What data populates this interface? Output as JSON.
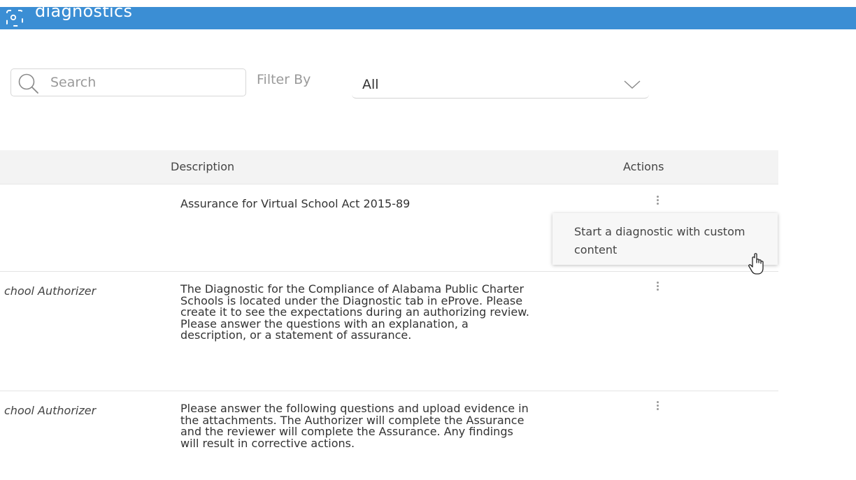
{
  "header": {
    "title": "diagnostics",
    "icon": "diagnostics-icon",
    "color": "#3b8ed4"
  },
  "search": {
    "placeholder": "Search",
    "value": ""
  },
  "filter": {
    "label": "Filter By",
    "selected": "All"
  },
  "table": {
    "columns": {
      "description": "Description",
      "actions": "Actions"
    },
    "rows": [
      {
        "name": "",
        "description": "Assurance for Virtual School Act 2015-89"
      },
      {
        "name": "chool Authorizer",
        "description": "The Diagnostic for the Compliance of Alabama Public Charter Schools is located under the Diagnostic tab in eProve. Please create it to see the expectations during an authorizing review. Please answer the questions with an explanation, a description, or a statement of assurance."
      },
      {
        "name": "chool Authorizer",
        "description": "Please answer the following questions and upload evidence in the attachments. The Authorizer will complete the Assurance and the reviewer will complete the Assurance. Any findings will result in corrective actions."
      }
    ]
  },
  "actions_menu": {
    "items": [
      "Start a diagnostic with custom content"
    ]
  }
}
